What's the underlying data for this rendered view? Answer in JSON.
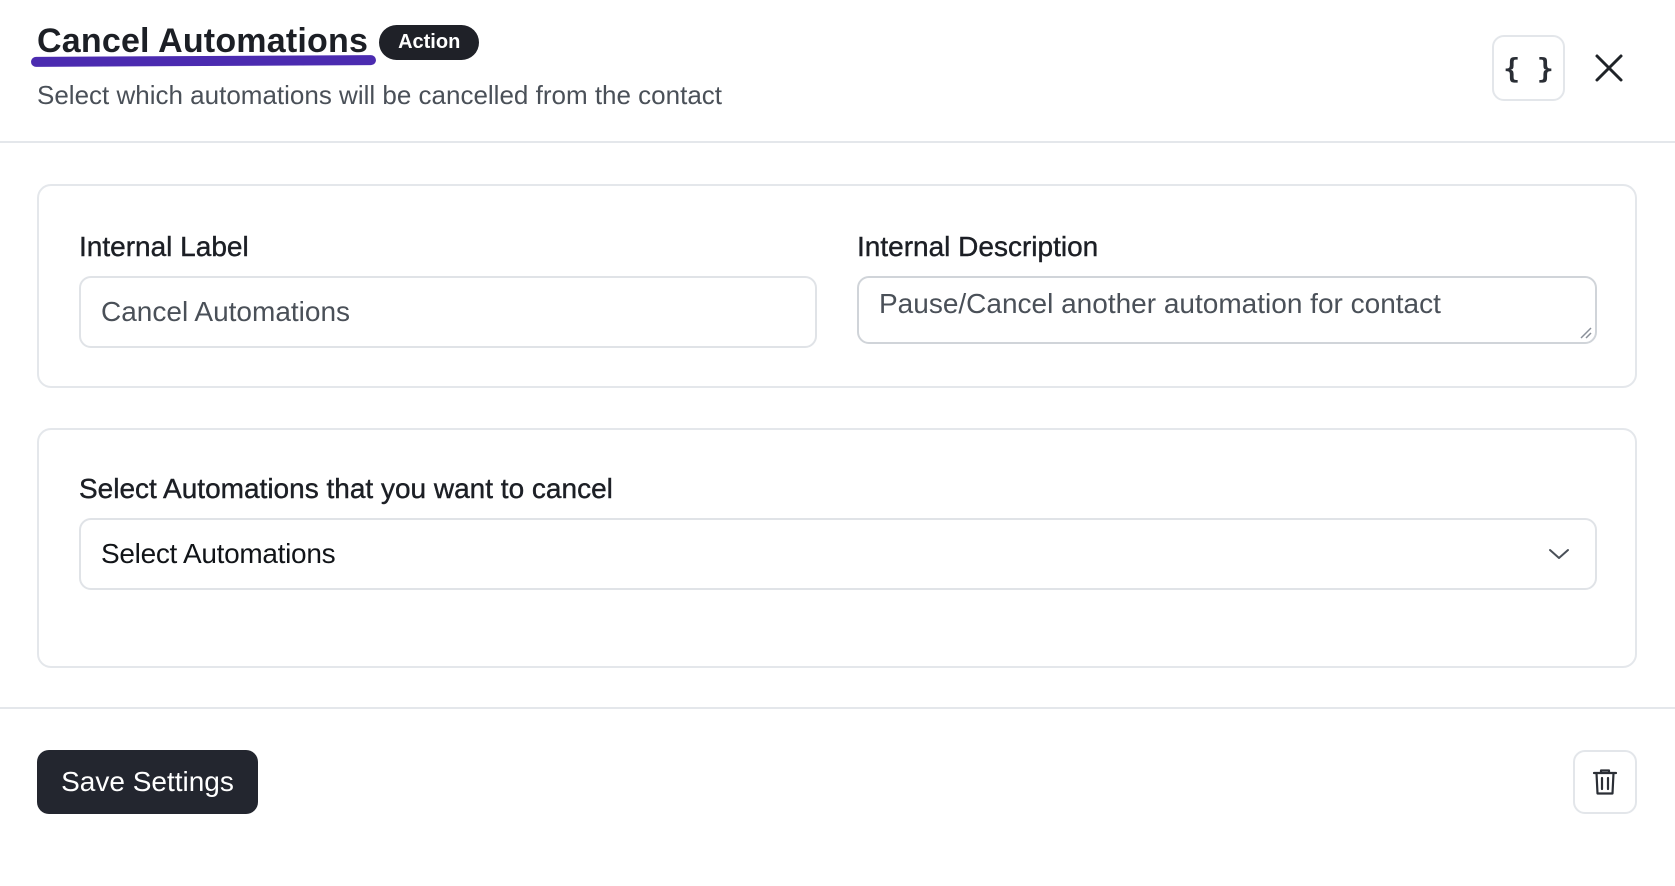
{
  "header": {
    "title": "Cancel Automations",
    "badge": "Action",
    "subtitle": "Select which automations will be cancelled from the contact",
    "code_button_glyph": "{ }",
    "close_icon": "close-icon"
  },
  "settings_card": {
    "internal_label": {
      "label": "Internal Label",
      "value": "Cancel Automations"
    },
    "internal_description": {
      "label": "Internal Description",
      "value": "Pause/Cancel another automation for contact"
    }
  },
  "automations_card": {
    "label": "Select Automations that you want to cancel",
    "select": {
      "selected": "Select Automations",
      "icon": "chevron-down-icon"
    }
  },
  "footer": {
    "save_label": "Save Settings",
    "delete_icon": "trash-icon"
  },
  "colors": {
    "accent_underline": "#4b2bb0",
    "primary_button": "#23262f",
    "border": "#e4e7eb"
  }
}
